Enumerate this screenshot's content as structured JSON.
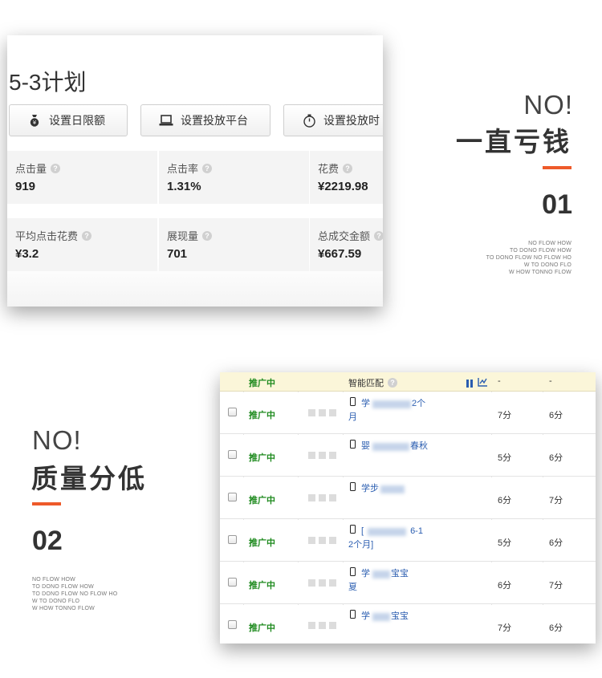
{
  "card1": {
    "plan_title": "5-3计划",
    "buttons": [
      {
        "label": "设置日限额",
        "icon": "money-bag-icon"
      },
      {
        "label": "设置投放平台",
        "icon": "laptop-icon"
      },
      {
        "label": "设置投放时",
        "icon": "stopwatch-icon"
      }
    ],
    "metrics": [
      {
        "label": "点击量",
        "value": "919"
      },
      {
        "label": "点击率",
        "value": "1.31%"
      },
      {
        "label": "花费",
        "value": "¥2219.98"
      },
      {
        "label": "平均点击花费",
        "value": "¥3.2"
      },
      {
        "label": "展现量",
        "value": "701"
      },
      {
        "label": "总成交金额",
        "value": "¥667.59"
      }
    ]
  },
  "section1": {
    "no": "NO!",
    "headline": "一直亏钱",
    "number": "01",
    "flow_lines": [
      "NO FLOW HOW",
      "TO DONO FLOW HOW",
      "TO DONO FLOW NO FLOW HO",
      "W TO DONO FLO",
      "W HOW TONNO FLOW"
    ]
  },
  "section2": {
    "no": "NO!",
    "headline": "质量分低",
    "number": "02",
    "flow_lines": [
      "NO FLOW HOW",
      "TO DONO FLOW HOW",
      "TO DONO FLOW NO FLOW HO",
      "W TO DONO FLO",
      "W HOW TONNO FLOW"
    ]
  },
  "table": {
    "header": {
      "status": "推广中",
      "smart_match": "智能匹配",
      "col_a": "-",
      "col_b": "-"
    },
    "rows": [
      {
        "status": "推广中",
        "kw_line1": "学",
        "kw_line1_tail": "2个",
        "kw_line2": "月",
        "score1": "7分",
        "score2": "6分"
      },
      {
        "status": "推广中",
        "kw_line1": "婴",
        "kw_line1_tail": "春秋",
        "kw_line2": "",
        "score1": "5分",
        "score2": "6分"
      },
      {
        "status": "推广中",
        "kw_line1": "学步",
        "kw_line1_tail": "",
        "kw_line2": "",
        "score1": "6分",
        "score2": "7分"
      },
      {
        "status": "推广中",
        "kw_line1": "[",
        "kw_line1_tail": "6-1",
        "kw_line2": "2个月]",
        "score1": "5分",
        "score2": "6分"
      },
      {
        "status": "推广中",
        "kw_line1": "学",
        "kw_line1_tail": "宝宝",
        "kw_line2": "夏",
        "score1": "6分",
        "score2": "7分"
      },
      {
        "status": "推广中",
        "kw_line1": "学",
        "kw_line1_tail": "宝宝",
        "kw_line2": "",
        "score1": "7分",
        "score2": "6分"
      }
    ]
  },
  "colors": {
    "accent": "#ee5a2a",
    "status_green": "#1e8a1e",
    "link_blue": "#2a5db0",
    "header_bg": "#fbf6d9"
  }
}
